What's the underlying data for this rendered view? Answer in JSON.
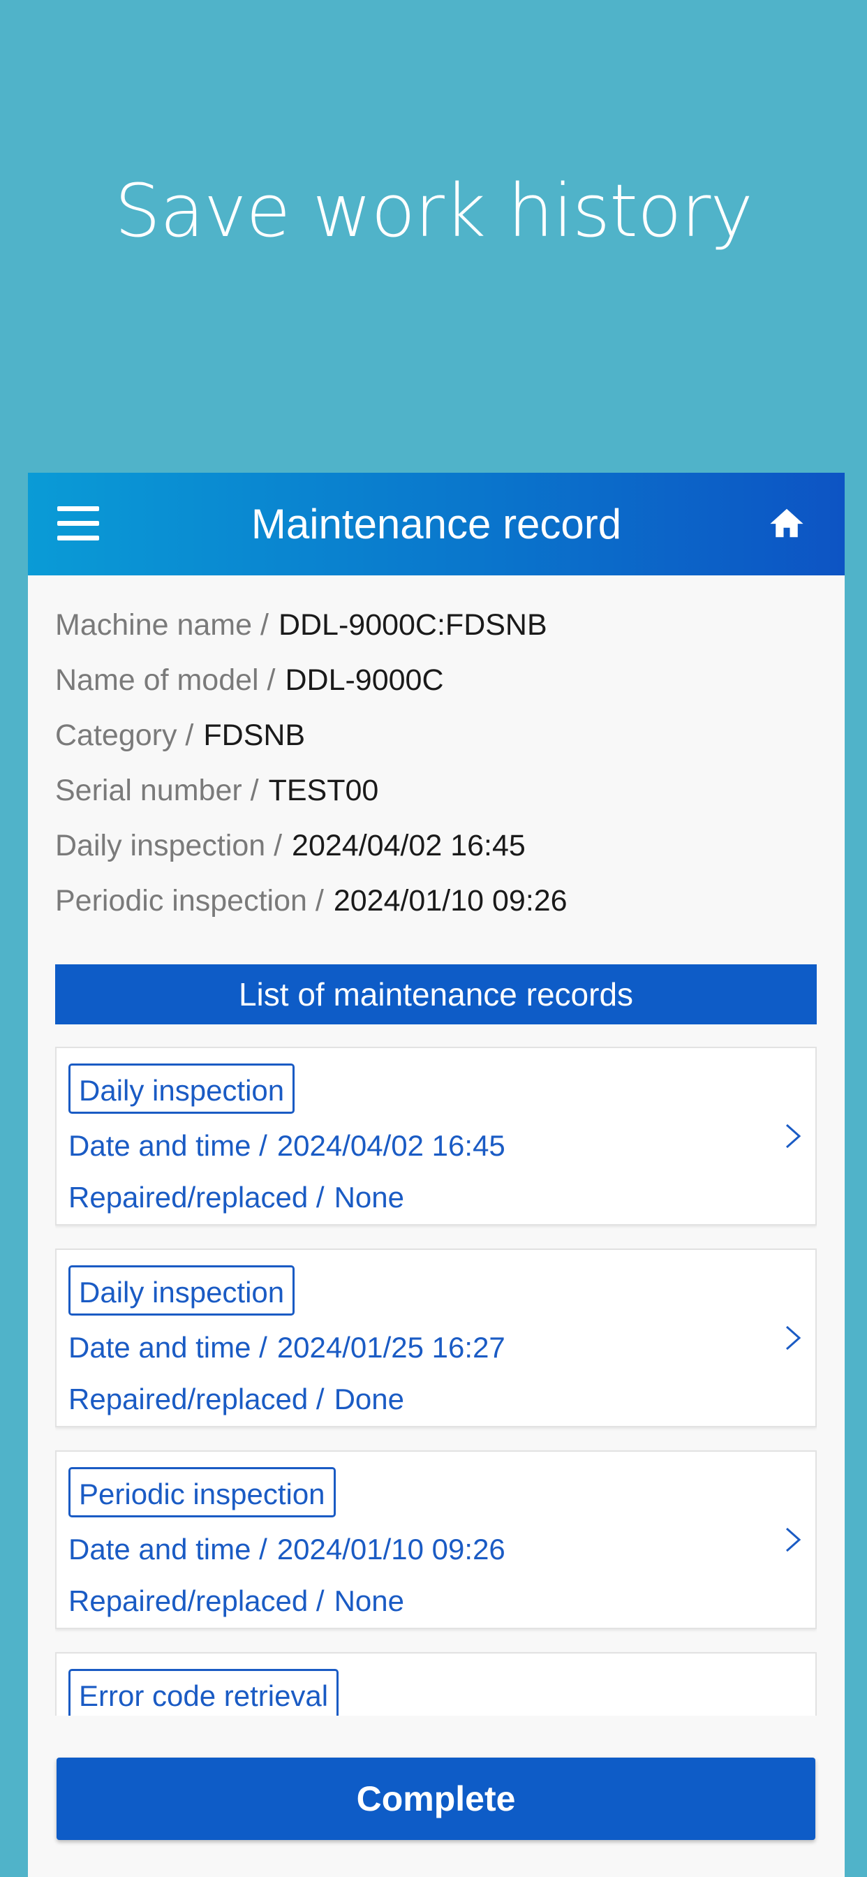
{
  "promo": {
    "title": "Save work history"
  },
  "header": {
    "title": "Maintenance record",
    "menu_icon": "hamburger-menu-icon",
    "home_icon": "home-icon"
  },
  "machine_info": [
    {
      "label": "Machine name /",
      "value": "DDL-9000C:FDSNB"
    },
    {
      "label": "Name of model /",
      "value": "DDL-9000C"
    },
    {
      "label": "Category /",
      "value": "FDSNB"
    },
    {
      "label": "Serial number /",
      "value": "TEST00"
    },
    {
      "label": "Daily inspection /",
      "value": "2024/04/02 16:45"
    },
    {
      "label": "Periodic inspection /",
      "value": "2024/01/10 09:26"
    }
  ],
  "records_section": {
    "title": "List of maintenance records"
  },
  "records": [
    {
      "type": "Daily inspection",
      "datetime_label": "Date and time /",
      "datetime": "2024/04/02 16:45",
      "repaired_label": "Repaired/replaced /",
      "repaired": "None"
    },
    {
      "type": "Daily inspection",
      "datetime_label": "Date and time /",
      "datetime": "2024/01/25 16:27",
      "repaired_label": "Repaired/replaced /",
      "repaired": "Done"
    },
    {
      "type": "Periodic inspection",
      "datetime_label": "Date and time /",
      "datetime": "2024/01/10 09:26",
      "repaired_label": "Repaired/replaced /",
      "repaired": "None"
    },
    {
      "type": "Error code retrieval"
    }
  ],
  "footer": {
    "complete_label": "Complete"
  },
  "colors": {
    "background": "#50b3c9",
    "header_start": "#0a9bd6",
    "header_end": "#0d54c4",
    "accent": "#0e5cc7",
    "record_text": "#1a5bc4"
  }
}
